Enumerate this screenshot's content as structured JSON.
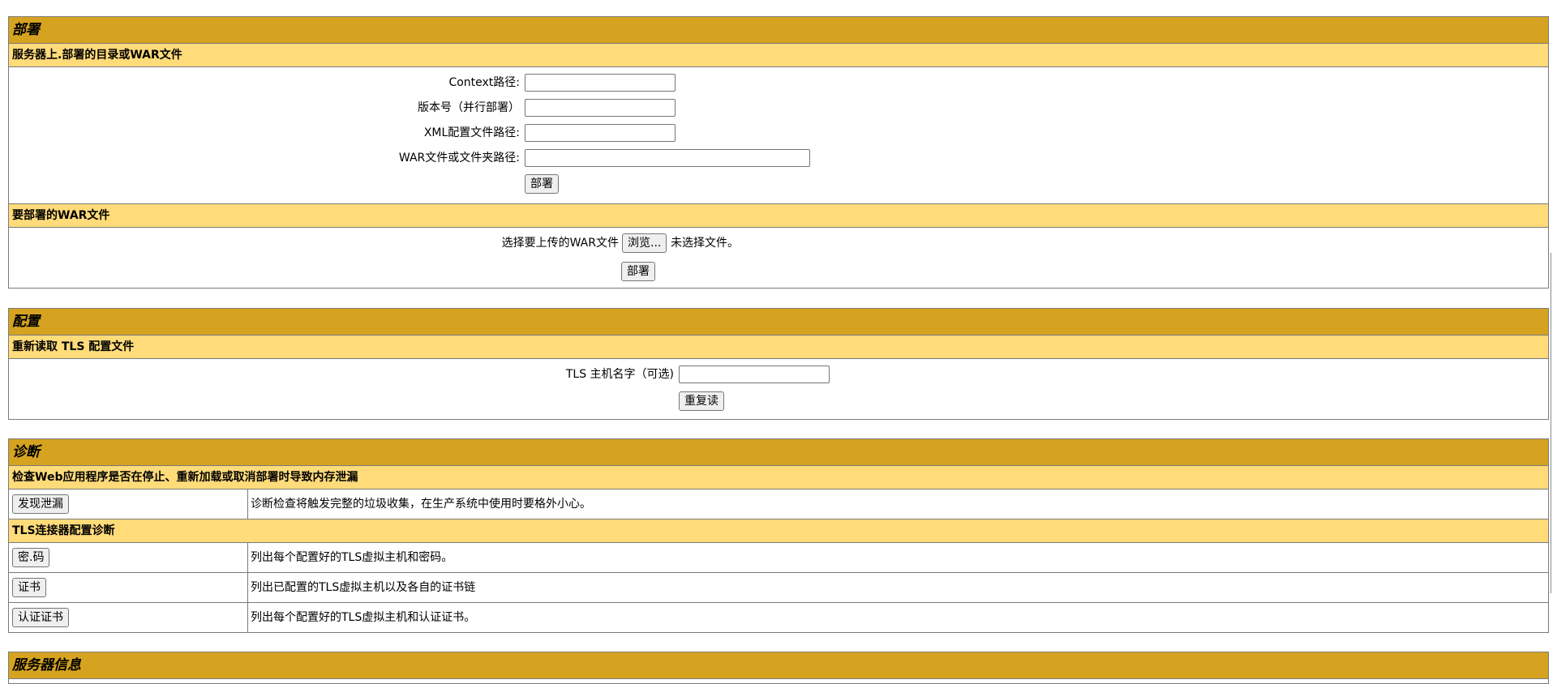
{
  "deploy": {
    "title": "部署",
    "server_sub": "服务器上.部署的目录或WAR文件",
    "context_label": "Context路径:",
    "context_value": "",
    "version_label": "版本号（并行部署）",
    "version_value": "",
    "xml_label": "XML配置文件路径:",
    "xml_value": "",
    "war_label": "WAR文件或文件夹路径:",
    "war_value": "",
    "deploy_button": "部署",
    "upload_sub": "要部署的WAR文件",
    "upload_label": "选择要上传的WAR文件",
    "browse_button": "浏览...",
    "no_file": "未选择文件。",
    "upload_deploy_button": "部署"
  },
  "config": {
    "title": "配置",
    "sub": "重新读取 TLS 配置文件",
    "host_label": "TLS 主机名字（可选)",
    "host_value": "",
    "reload_button": "重复读"
  },
  "diagnostics": {
    "title": "诊断",
    "leak_sub": "检查Web应用程序是否在停止、重新加载或取消部署时导致内存泄漏",
    "leak_button": "发现泄漏",
    "leak_desc": "诊断检查将触发完整的垃圾收集，在生产系统中使用时要格外小心。",
    "tls_sub": "TLS连接器配置诊断",
    "tls_rows": [
      {
        "button": "密.码",
        "desc": "列出每个配置好的TLS虚拟主机和密码。"
      },
      {
        "button": "证书",
        "desc": "列出已配置的TLS虚拟主机以及各自的证书链"
      },
      {
        "button": "认证证书",
        "desc": "列出每个配置好的TLS虚拟主机和认证证书。"
      }
    ]
  },
  "server_info": {
    "title": "服务器信息"
  }
}
